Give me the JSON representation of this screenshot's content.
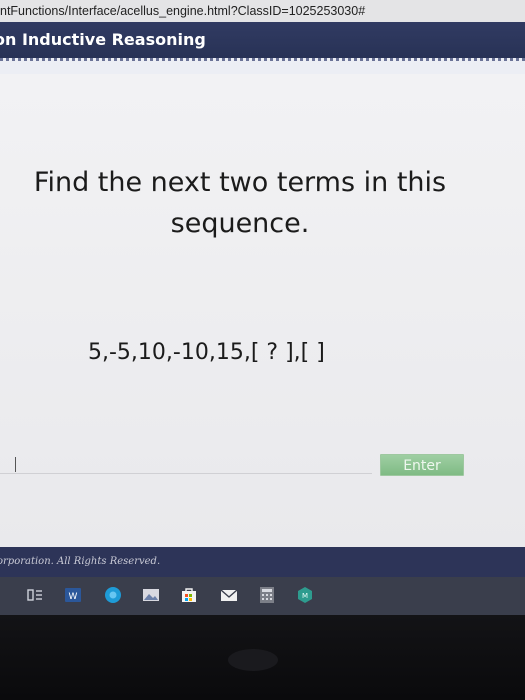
{
  "browser": {
    "url": "ntFunctions/Interface/acellus_engine.html?ClassID=1025253030#"
  },
  "header": {
    "title": "on Inductive Reasoning"
  },
  "question": {
    "prompt": "Find the next two terms in this sequence.",
    "sequence": "5,-5,10,-10,15,[  ?  ],[     ]"
  },
  "answer": {
    "value": "",
    "enter_label": "Enter"
  },
  "footer": {
    "text": "orporation.  All Rights Reserved."
  },
  "taskbar": {
    "icons": [
      "task-view-icon",
      "word-icon",
      "browser-icon",
      "photos-icon",
      "store-icon",
      "mail-icon",
      "calculator-icon",
      "app-icon"
    ]
  },
  "colors": {
    "header_bg": "#2c3560",
    "enter_button": "#8cc391",
    "taskbar_bg": "#3a3e4c"
  }
}
